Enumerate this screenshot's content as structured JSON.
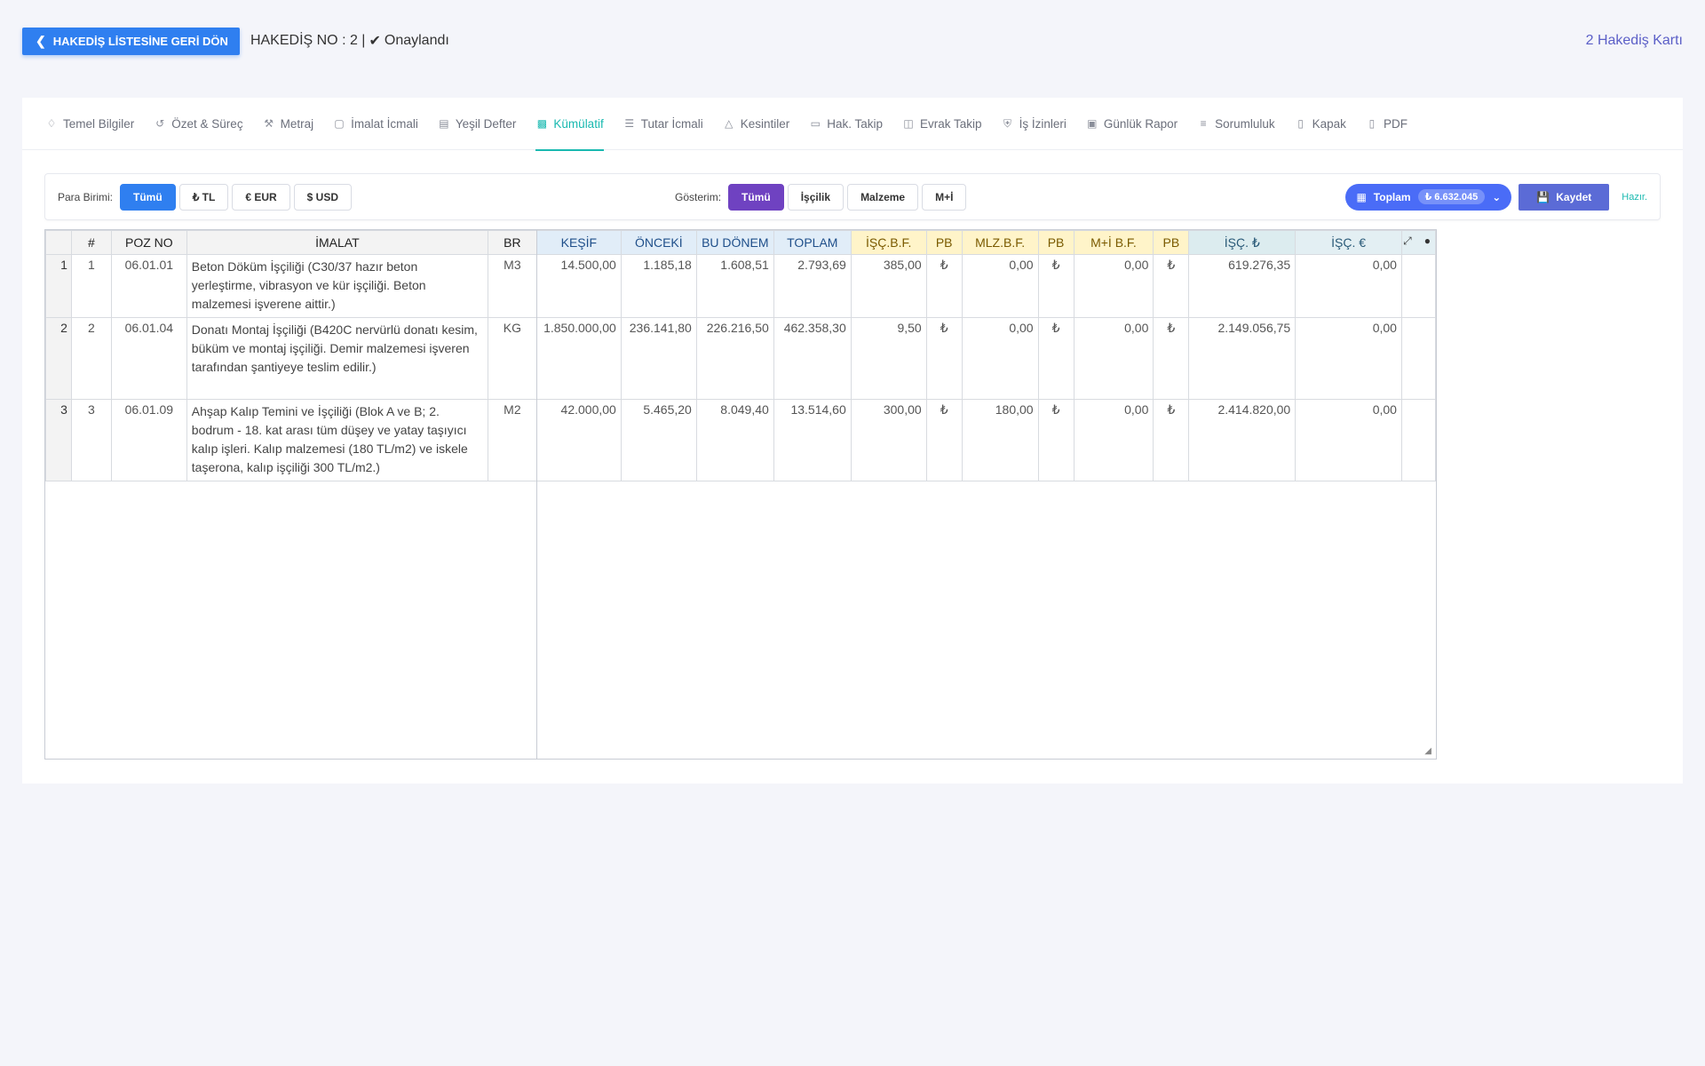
{
  "header": {
    "back_label": "HAKEDİŞ LİSTESİNE GERİ DÖN",
    "hakedis_no": "HAKEDİŞ NO : 2 |",
    "status": "Onaylandı",
    "card_link": "2 Hakediş Kartı"
  },
  "tabs": [
    {
      "label": "Temel Bilgiler",
      "icon": "tag-icon"
    },
    {
      "label": "Özet & Süreç",
      "icon": "history-icon"
    },
    {
      "label": "Metraj",
      "icon": "hammer-icon"
    },
    {
      "label": "İmalat İcmali",
      "icon": "box-icon"
    },
    {
      "label": "Yeşil Defter",
      "icon": "book-icon"
    },
    {
      "label": "Kümülatif",
      "icon": "chart-icon",
      "active": true
    },
    {
      "label": "Tutar İcmali",
      "icon": "document-icon"
    },
    {
      "label": "Kesintiler",
      "icon": "warning-icon"
    },
    {
      "label": "Hak. Takip",
      "icon": "file-icon"
    },
    {
      "label": "Evrak Takip",
      "icon": "files-icon"
    },
    {
      "label": "İş İzinleri",
      "icon": "shield-icon"
    },
    {
      "label": "Günlük Rapor",
      "icon": "calendar-icon"
    },
    {
      "label": "Sorumluluk",
      "icon": "list-icon"
    },
    {
      "label": "Kapak",
      "icon": "page-icon"
    },
    {
      "label": "PDF",
      "icon": "pdf-icon"
    }
  ],
  "filters": {
    "para_label": "Para Birimi:",
    "para_options": [
      "Tümü",
      "₺ TL",
      "€ EUR",
      "$ USD"
    ],
    "gosterim_label": "Gösterim:",
    "gosterim_options": [
      "Tümü",
      "İşçilik",
      "Malzeme",
      "M+İ"
    ],
    "toplam_label": "Toplam",
    "toplam_value": "₺ 6.632.045",
    "kaydet_label": "Kaydet",
    "status": "Hazır."
  },
  "table": {
    "headers": [
      "#",
      "POZ NO",
      "İMALAT",
      "BR",
      "KEŞİF",
      "ÖNCEKİ",
      "BU DÖNEM",
      "TOPLAM",
      "İŞÇ.B.F.",
      "PB",
      "MLZ.B.F.",
      "PB",
      "M+İ B.F.",
      "PB",
      "İŞÇ. ₺",
      "İŞÇ. €"
    ],
    "rows": [
      {
        "rn": "1",
        "no": "1",
        "poz": "06.01.01",
        "imalat": "Beton Döküm İşçiliği (C30/37 hazır beton yerleştirme, vibrasyon ve kür işçiliği. Beton malzemesi işverene aittir.)",
        "br": "M3",
        "kesif": "14.500,00",
        "onceki": "1.185,18",
        "bu_donem": "1.608,51",
        "toplam": "2.793,69",
        "isc_bf": "385,00",
        "pb1": "₺",
        "mlz_bf": "0,00",
        "pb2": "₺",
        "mi_bf": "0,00",
        "pb3": "₺",
        "isc_tl": "619.276,35",
        "isc_eur": "0,00"
      },
      {
        "rn": "2",
        "no": "2",
        "poz": "06.01.04",
        "imalat": "Donatı Montaj İşçiliği (B420C nervürlü donatı kesim, büküm ve montaj işçiliği. Demir malzemesi işveren tarafından şantiyeye teslim edilir.)",
        "br": "KG",
        "kesif": "1.850.000,00",
        "onceki": "236.141,80",
        "bu_donem": "226.216,50",
        "toplam": "462.358,30",
        "isc_bf": "9,50",
        "pb1": "₺",
        "mlz_bf": "0,00",
        "pb2": "₺",
        "mi_bf": "0,00",
        "pb3": "₺",
        "isc_tl": "2.149.056,75",
        "isc_eur": "0,00"
      },
      {
        "rn": "3",
        "no": "3",
        "poz": "06.01.09",
        "imalat": "Ahşap Kalıp Temini ve İşçiliği (Blok A ve B; 2. bodrum - 18. kat arası tüm düşey ve yatay taşıyıcı kalıp işleri. Kalıp malzemesi (180 TL/m2) ve iskele taşerona, kalıp işçiliği 300 TL/m2.)",
        "br": "M2",
        "kesif": "42.000,00",
        "onceki": "5.465,20",
        "bu_donem": "8.049,40",
        "toplam": "13.514,60",
        "isc_bf": "300,00",
        "pb1": "₺",
        "mlz_bf": "180,00",
        "pb2": "₺",
        "mi_bf": "0,00",
        "pb3": "₺",
        "isc_tl": "2.414.820,00",
        "isc_eur": "0,00"
      }
    ]
  },
  "colors": {
    "primary_blue": "#2f7ff0",
    "purple": "#6f42c1",
    "teal": "#19b9b0",
    "indigo": "#5b6bd6"
  }
}
